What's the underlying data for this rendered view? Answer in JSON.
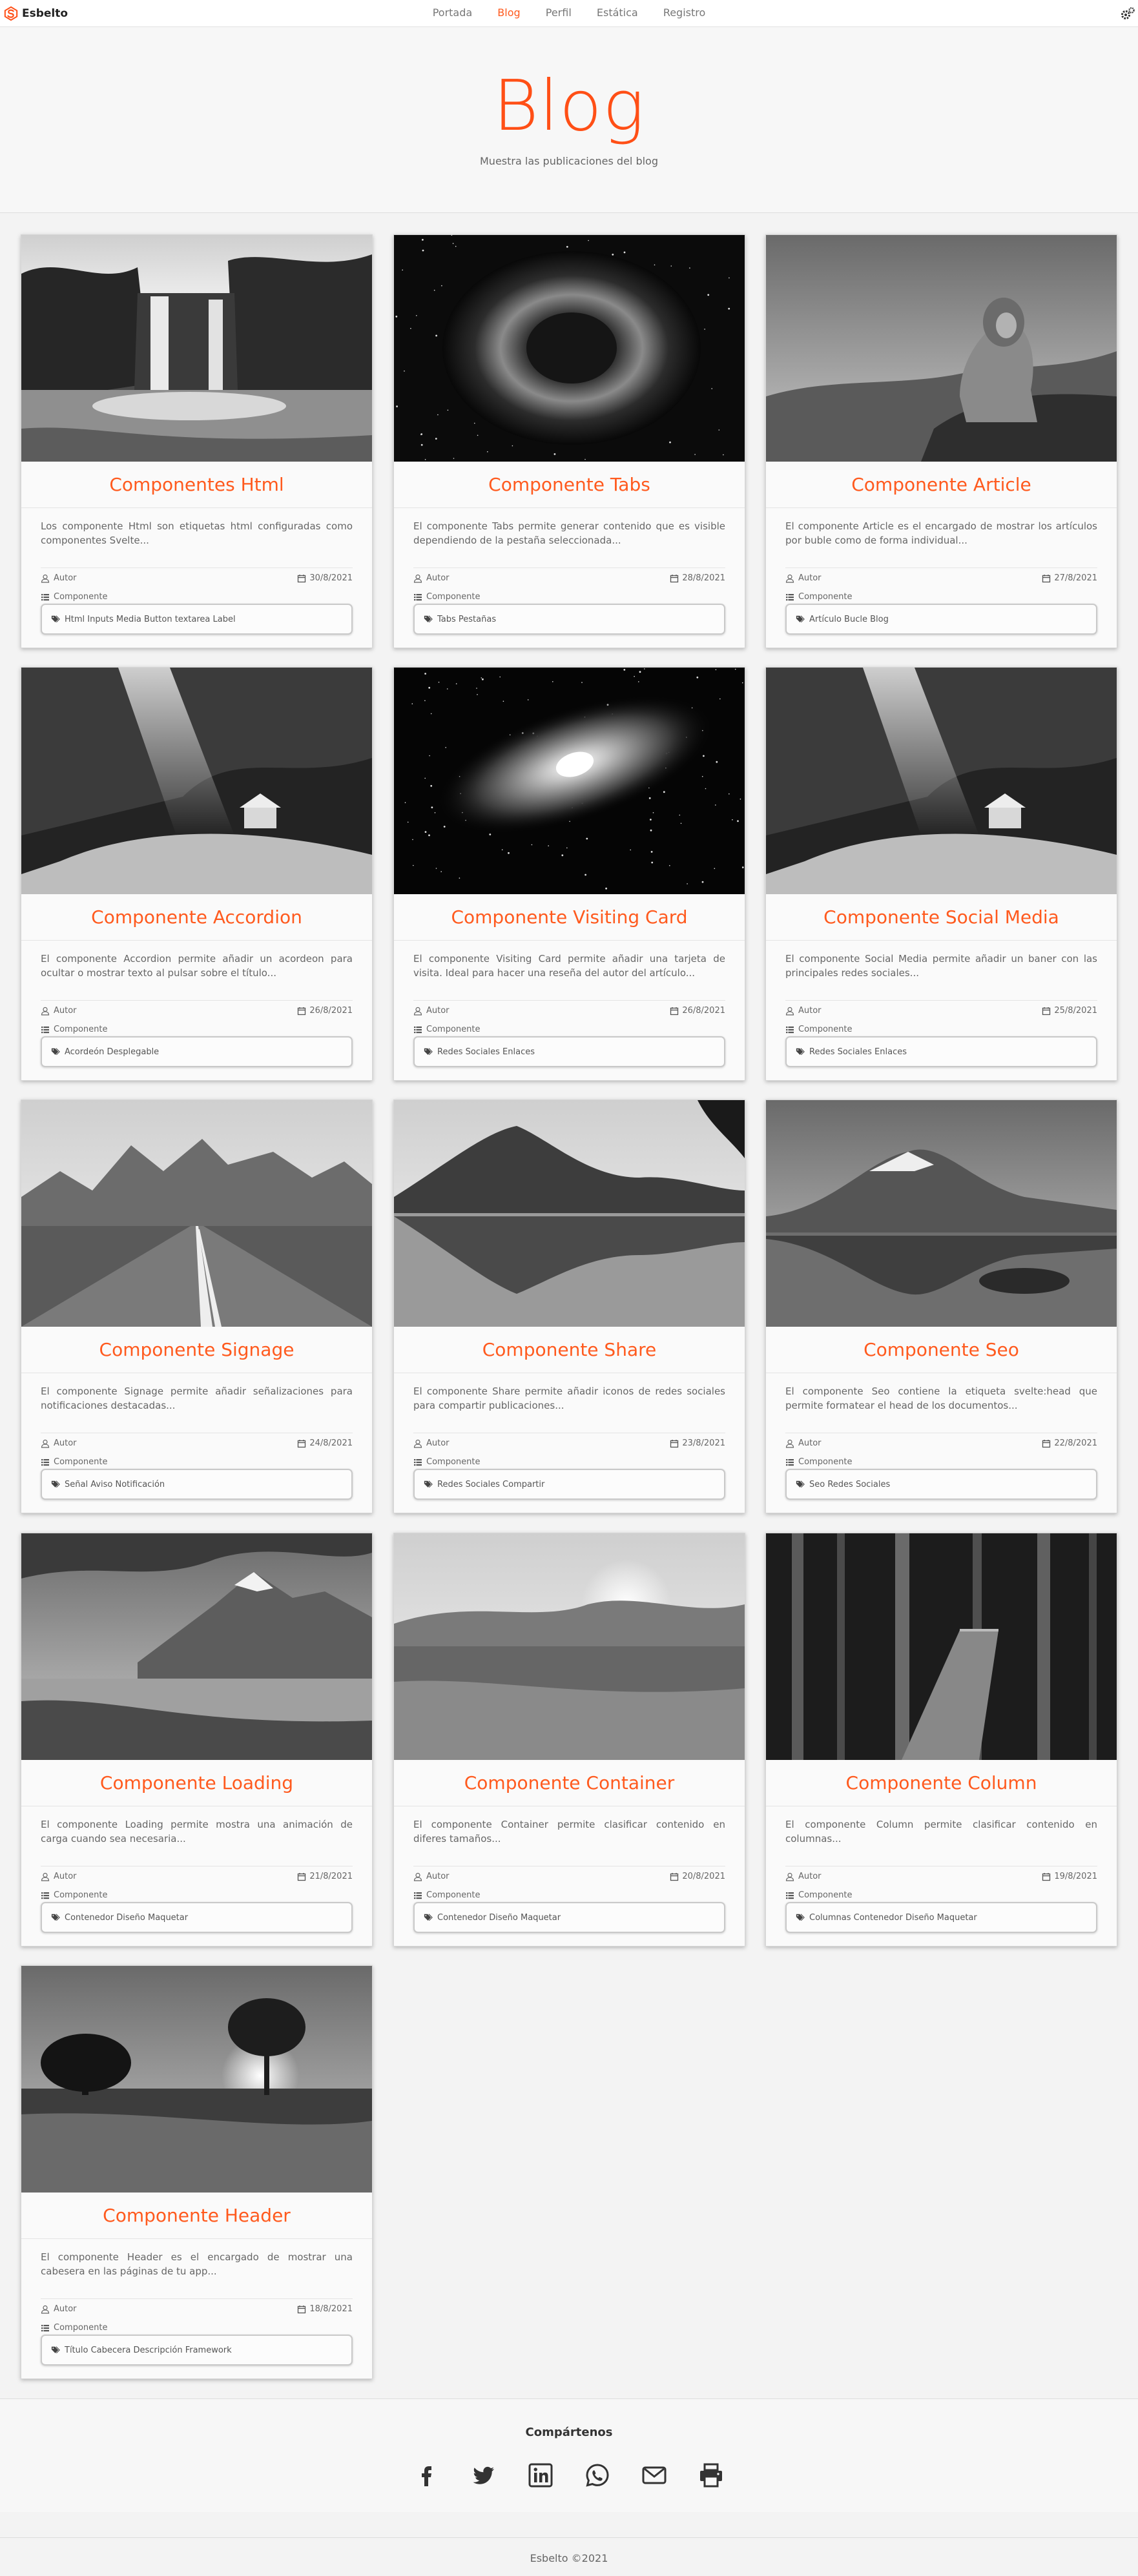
{
  "brand": {
    "name": "Esbelto",
    "accent_color": "#ff4f16"
  },
  "nav": {
    "links": [
      {
        "label": "Portada",
        "active": false
      },
      {
        "label": "Blog",
        "active": true
      },
      {
        "label": "Perfil",
        "active": false
      },
      {
        "label": "Estática",
        "active": false
      },
      {
        "label": "Registro",
        "active": false
      }
    ],
    "settings_icon": "gear-icon"
  },
  "hero": {
    "title": "Blog",
    "subtitle": "Muestra las publicaciones del blog"
  },
  "posts": [
    {
      "title": "Componentes Html",
      "excerpt": "Los componente Html son etiquetas html configuradas como componentes Svelte...",
      "author": "Autor",
      "date": "30/8/2021",
      "category": "Componente",
      "tags": "Html Inputs Media Button textarea Label",
      "image": "waterfall"
    },
    {
      "title": "Componente Tabs",
      "excerpt": "El componente Tabs permite generar contenido que es visible dependiendo de la pestaña seleccionada...",
      "author": "Autor",
      "date": "28/8/2021",
      "category": "Componente",
      "tags": "Tabs Pestañas",
      "image": "nebula"
    },
    {
      "title": "Componente Article",
      "excerpt": "El componente Article es el encargado de mostrar los artículos por buble como de forma individual...",
      "author": "Autor",
      "date": "27/8/2021",
      "category": "Componente",
      "tags": "Artículo Bucle Blog",
      "image": "lion"
    },
    {
      "title": "Componente Accordion",
      "excerpt": "El componente Accordion permite añadir un acordeon para ocultar o mostrar texto al pulsar sobre el título...",
      "author": "Autor",
      "date": "26/8/2021",
      "category": "Componente",
      "tags": "Acordeón Desplegable",
      "image": "cave"
    },
    {
      "title": "Componente Visiting Card",
      "excerpt": "El componente Visiting Card permite añadir una tarjeta de visita. Ideal para hacer una reseña del autor del artículo...",
      "author": "Autor",
      "date": "26/8/2021",
      "category": "Componente",
      "tags": "Redes Sociales Enlaces",
      "image": "galaxy"
    },
    {
      "title": "Componente Social Media",
      "excerpt": "El componente Social Media permite añadir un baner con las principales redes sociales...",
      "author": "Autor",
      "date": "25/8/2021",
      "category": "Componente",
      "tags": "Redes Sociales Enlaces",
      "image": "cave"
    },
    {
      "title": "Componente Signage",
      "excerpt": "El componente Signage permite añadir señalizaciones para notificaciones destacadas...",
      "author": "Autor",
      "date": "24/8/2021",
      "category": "Componente",
      "tags": "Señal Aviso Notificación",
      "image": "road"
    },
    {
      "title": "Componente Share",
      "excerpt": "El componente Share permite añadir iconos de redes sociales para compartir publicaciones...",
      "author": "Autor",
      "date": "23/8/2021",
      "category": "Componente",
      "tags": "Redes Sociales Compartir",
      "image": "lake"
    },
    {
      "title": "Componente Seo",
      "excerpt": "El componente Seo contiene la etiqueta svelte:head que permite formatear el head de los documentos...",
      "author": "Autor",
      "date": "22/8/2021",
      "category": "Componente",
      "tags": "Seo Redes Sociales",
      "image": "peak"
    },
    {
      "title": "Componente Loading",
      "excerpt": "El componente Loading permite mostra una animación de carga cuando sea necesaria...",
      "author": "Autor",
      "date": "21/8/2021",
      "category": "Componente",
      "tags": "Contenedor Diseño Maquetar",
      "image": "mountains"
    },
    {
      "title": "Componente Container",
      "excerpt": "El componente Container permite clasificar contenido en diferes tamaños...",
      "author": "Autor",
      "date": "20/8/2021",
      "category": "Componente",
      "tags": "Contenedor Diseño Maquetar",
      "image": "sunset"
    },
    {
      "title": "Componente Column",
      "excerpt": "El componente Column permite clasificar contenido en columnas...",
      "author": "Autor",
      "date": "19/8/2021",
      "category": "Componente",
      "tags": "Columnas Contenedor Diseño Maquetar",
      "image": "forest"
    },
    {
      "title": "Componente Header",
      "excerpt": "El componente Header es el encargado de mostrar una cabesera en las páginas de tu app...",
      "author": "Autor",
      "date": "18/8/2021",
      "category": "Componente",
      "tags": "Título Cabecera Descripción Framework",
      "image": "tree"
    }
  ],
  "share": {
    "title": "Compártenos",
    "icons": [
      "facebook-icon",
      "twitter-icon",
      "linkedin-icon",
      "whatsapp-icon",
      "email-icon",
      "print-icon"
    ]
  },
  "footer": {
    "text": "Esbelto ©2021"
  }
}
